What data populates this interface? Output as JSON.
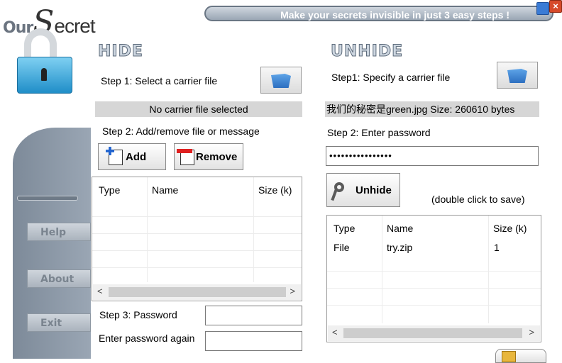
{
  "header": {
    "logo_prefix": "Our",
    "logo_big": "S",
    "logo_rest": "ecret",
    "banner": "Make your secrets invisible in just 3 easy steps !",
    "close_glyph": "×"
  },
  "sidebar": {
    "buttons": [
      "Help",
      "About",
      "Exit"
    ]
  },
  "hide": {
    "title": "HIDE",
    "step1": "Step 1: Select a carrier file",
    "status": "No carrier file selected",
    "step2": "Step 2: Add/remove file or message",
    "add_label": "Add",
    "remove_label": "Remove",
    "columns": [
      "Type",
      "Name",
      "Size (k)"
    ],
    "step3": "Step 3: Password",
    "password_again": "Enter password again",
    "scroll_left": "<",
    "scroll_right": ">"
  },
  "unhide": {
    "title": "UNHIDE",
    "step1": "Step1: Specify a carrier file",
    "file_info": "我们的秘密是green.jpg   Size: 260610 bytes",
    "step2": "Step 2: Enter password",
    "password_value": "••••••••••••••••",
    "unhide_label": "Unhide",
    "hint": "(double click to save)",
    "columns": [
      "Type",
      "Name",
      "Size (k)"
    ],
    "rows": [
      {
        "type": "File",
        "name": "try.zip",
        "size": "1"
      }
    ],
    "scroll_left": "<",
    "scroll_right": ">"
  },
  "colors": {
    "accent_blue": "#1f8ec8",
    "sidebar_gray": "#8a96a4",
    "banner": "#9aa6b4"
  },
  "icons": [
    "lock-icon",
    "folder-icon",
    "add-file-icon",
    "remove-file-icon",
    "key-icon",
    "minimize-icon",
    "close-icon"
  ]
}
